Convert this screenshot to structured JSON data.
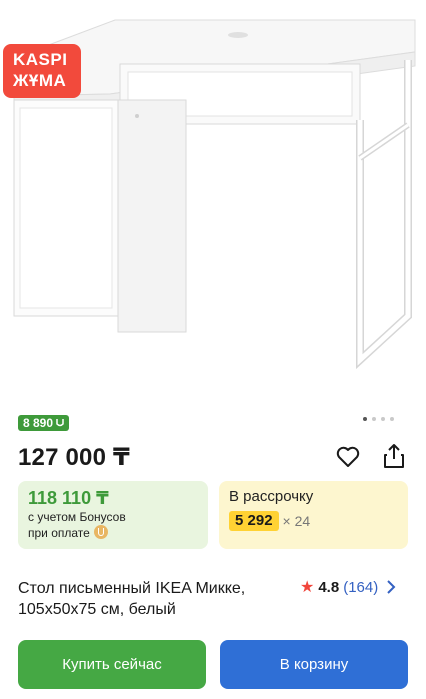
{
  "product": {
    "badge_line1": "KASPI",
    "badge_line2": "ЖҰМА",
    "gallery_dots": 4,
    "bonus_chip": "8 890 ",
    "price": "127 000 ₸",
    "title": "Стол письменный IKEA Микке, 105х50х75 см, белый",
    "rating": "4.8",
    "reviews": "(164)"
  },
  "bonus_card": {
    "amount": "118 110 ₸",
    "line1": "с учетом Бонусов",
    "line2": "при оплате"
  },
  "credit_card": {
    "title": "В рассрочку",
    "monthly": "5 292",
    "months": "× 24"
  },
  "buttons": {
    "buy": "Купить сейчас",
    "cart": "В корзину"
  },
  "colors": {
    "badge": "#f24a3c",
    "bonus_green": "#3e9a3a",
    "buy_button": "#45a844",
    "cart_button": "#2f6fd6",
    "monthly_chip": "#ffd233",
    "star": "#f1463c",
    "reviews_link": "#3461c2"
  },
  "icons": [
    "heart-icon",
    "share-icon",
    "star-icon",
    "chevron-right-icon",
    "bonus-coin-icon"
  ]
}
